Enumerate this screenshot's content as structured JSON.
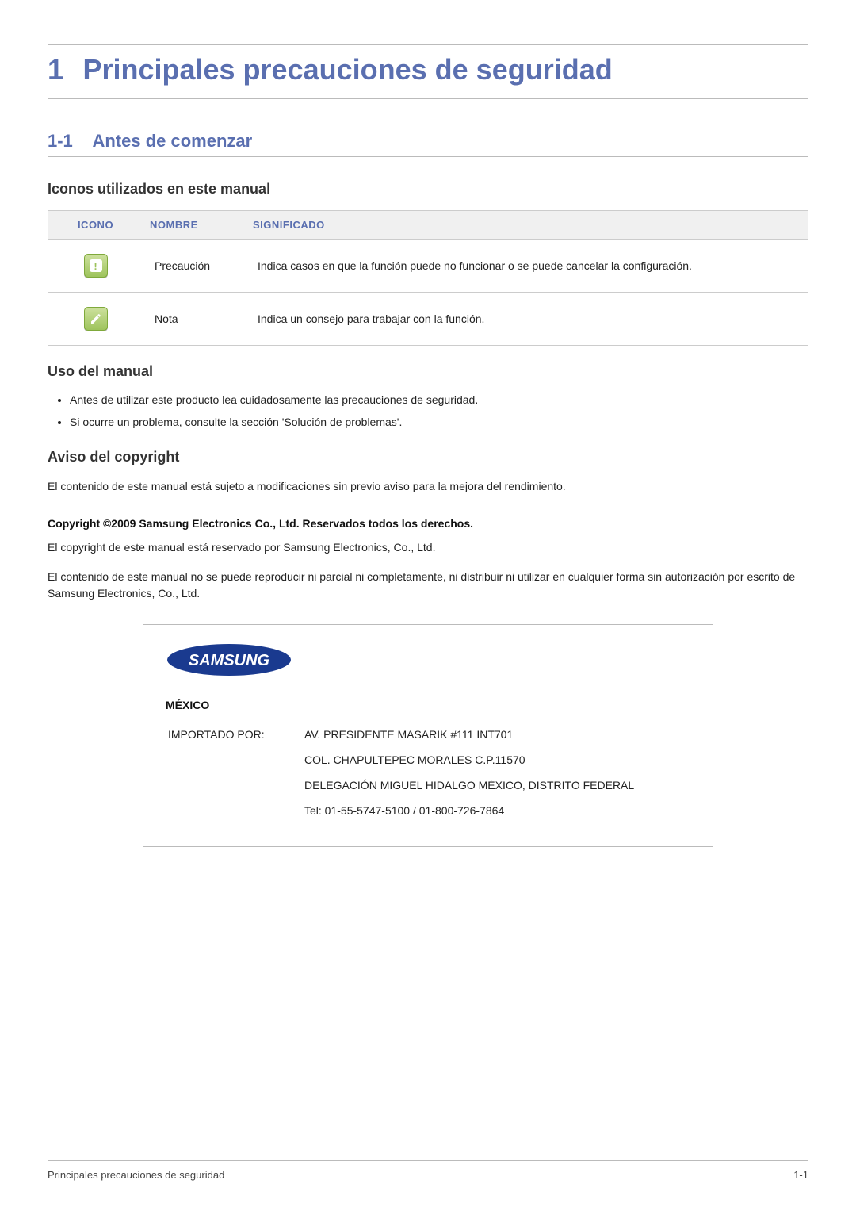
{
  "chapter": {
    "number": "1",
    "title": "Principales precauciones de seguridad"
  },
  "section": {
    "number": "1-1",
    "title": "Antes de comenzar"
  },
  "icons_subhead": "Iconos utilizados en este manual",
  "icon_table": {
    "headers": {
      "icon": "ICONO",
      "name": "NOMBRE",
      "meaning": "SIGNIFICADO"
    },
    "rows": [
      {
        "name": "Precaución",
        "meaning": "Indica casos en que la función puede no funcionar o se puede cancelar la configuración."
      },
      {
        "name": "Nota",
        "meaning": "Indica un consejo para trabajar con la función."
      }
    ]
  },
  "usage": {
    "title": "Uso del manual",
    "bullets": [
      "Antes de utilizar este producto lea cuidadosamente las precauciones de seguridad.",
      "Si ocurre un problema, consulte la sección 'Solución de problemas'."
    ]
  },
  "copyright": {
    "title": "Aviso del copyright",
    "p1": "El contenido de este manual está sujeto a modificaciones sin previo aviso para la mejora del rendimiento.",
    "bold": "Copyright ©2009 Samsung Electronics Co., Ltd. Reservados todos los derechos.",
    "p2": "El copyright de este manual está reservado por Samsung Electronics, Co., Ltd.",
    "p3": "El contenido de este manual no se puede reproducir ni parcial ni completamente, ni distribuir ni utilizar en cualquier forma sin autorización por escrito de Samsung Electronics, Co., Ltd."
  },
  "infobox": {
    "logo_text": "SAMSUNG",
    "country": "MÉXICO",
    "import_label": "IMPORTADO POR:",
    "lines": [
      "AV. PRESIDENTE MASARIK #111 INT701",
      "COL. CHAPULTEPEC MORALES C.P.11570",
      "DELEGACIÓN MIGUEL HIDALGO MÉXICO, DISTRITO FEDERAL",
      "Tel: 01-55-5747-5100 / 01-800-726-7864"
    ]
  },
  "footer": {
    "left": "Principales precauciones de seguridad",
    "right": "1-1"
  }
}
